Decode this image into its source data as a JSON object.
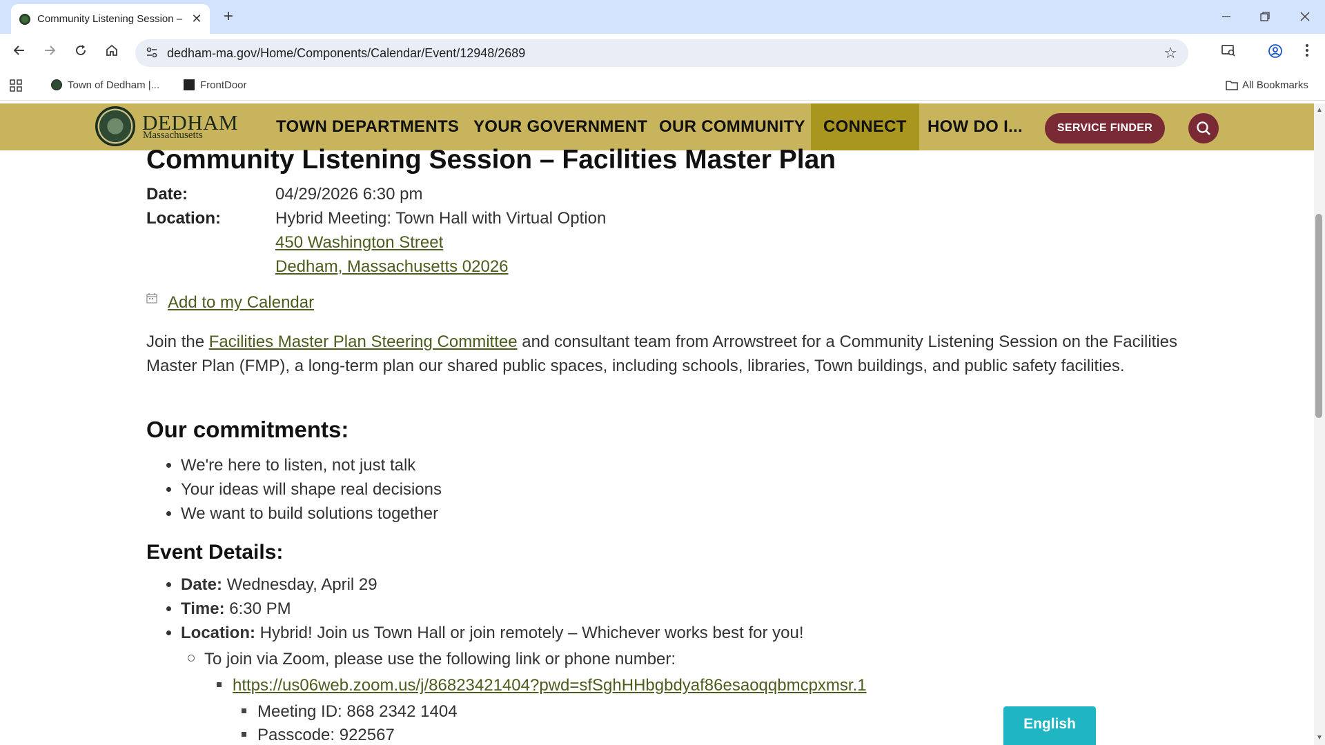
{
  "browser": {
    "tab_title": "Community Listening Session –",
    "tab_close": "✕",
    "new_tab": "+",
    "url": "dedham-ma.gov/Home/Components/Calendar/Event/12948/2689",
    "bookmarks": [
      {
        "label": "Town of Dedham |..."
      },
      {
        "label": "FrontDoor"
      }
    ],
    "all_bookmarks": "All Bookmarks"
  },
  "site": {
    "logo_name": "DEDHAM",
    "logo_sub": "Massachusetts",
    "nav": [
      {
        "label": "TOWN DEPARTMENTS"
      },
      {
        "label": "YOUR GOVERNMENT"
      },
      {
        "label": "OUR COMMUNITY"
      },
      {
        "label": "CONNECT"
      },
      {
        "label": "HOW DO I..."
      }
    ],
    "service_finder": "SERVICE FINDER",
    "brand_color": "#c7b45c",
    "accent_color": "#7a2a35"
  },
  "event": {
    "title": "Community Listening Session – Facilities Master Plan",
    "date_label": "Date:",
    "date_value": "04/29/2026 6:30 pm",
    "location_label": "Location:",
    "location_line1": "Hybrid Meeting: Town Hall with Virtual Option",
    "location_line2": "450 Washington Street",
    "location_line3": "Dedham, Massachusetts 02026",
    "add_calendar": "Add to my Calendar",
    "intro_before": "Join the ",
    "intro_link": "Facilities Master Plan Steering Committee",
    "intro_after": " and consultant team from Arrowstreet for a Community Listening Session on the Facilities Master Plan (FMP), a long-term plan our shared public spaces, including schools, libraries, Town buildings, and public safety facilities.",
    "commitments_heading": "Our commitments:",
    "commitments": [
      "We're here to listen, not just talk",
      "Your ideas will shape real decisions",
      "We want to build solutions together"
    ],
    "details_heading": "Event Details:",
    "details": {
      "date_label": "Date:",
      "date_value": " Wednesday, April 29",
      "time_label": "Time:",
      "time_value": " 6:30 PM",
      "location_label": "Location:",
      "location_value": " Hybrid! Join us Town Hall or join remotely – Whichever works best for you!"
    },
    "zoom_intro": "To join via Zoom, please use the following link or phone number:",
    "zoom_link": "https://us06web.zoom.us/j/86823421404?pwd=sfSghHHbgbdyaf86esaoqqbmcpxmsr.1",
    "meeting_id": "Meeting ID: 868 2342 1404",
    "passcode": "Passcode: 922567"
  },
  "language_button": "English"
}
